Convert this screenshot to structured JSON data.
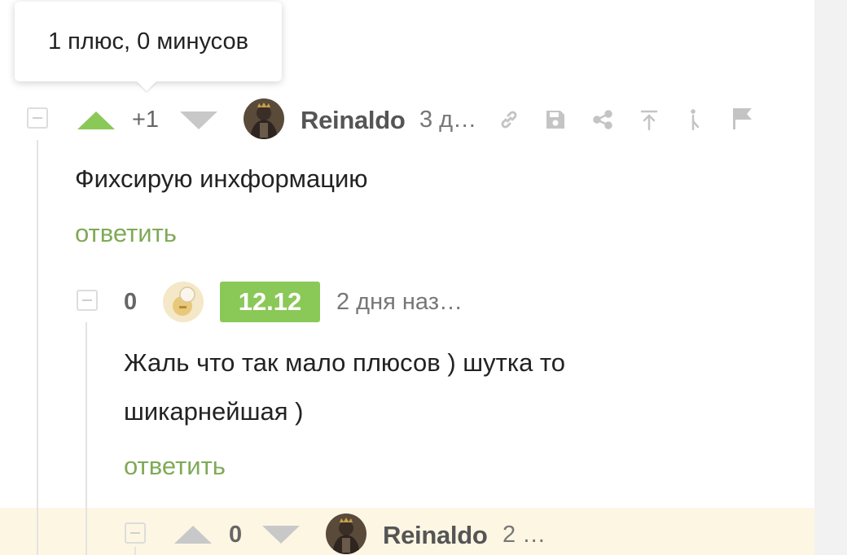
{
  "tooltip": {
    "text": "1 плюс, 0 минусов"
  },
  "comments": [
    {
      "rating": "+1",
      "author": "Reinaldo",
      "time": "3 д…",
      "text": "Фихсирую инхформацию",
      "reply_label": "ответить",
      "vote_up_active_color": "#8ac858"
    },
    {
      "rating": "0",
      "author_badge": "12.12",
      "time": "2 дня наз…",
      "text_lines": [
        "Жаль что так мало плюсов ) шутка то",
        "шикарнейшая )"
      ],
      "reply_label": "ответить"
    },
    {
      "rating": "0",
      "author": "Reinaldo",
      "time": "2 …"
    }
  ],
  "icons": [
    "collapse-icon",
    "arrow-up-icon",
    "arrow-down-icon",
    "link-icon",
    "save-icon",
    "share-icon",
    "scroll-to-top-icon",
    "branch-icon",
    "flag-icon"
  ],
  "colors": {
    "accent_green": "#8ac858",
    "reply_green": "#7faa57",
    "highlight": "#fdf6e3"
  }
}
